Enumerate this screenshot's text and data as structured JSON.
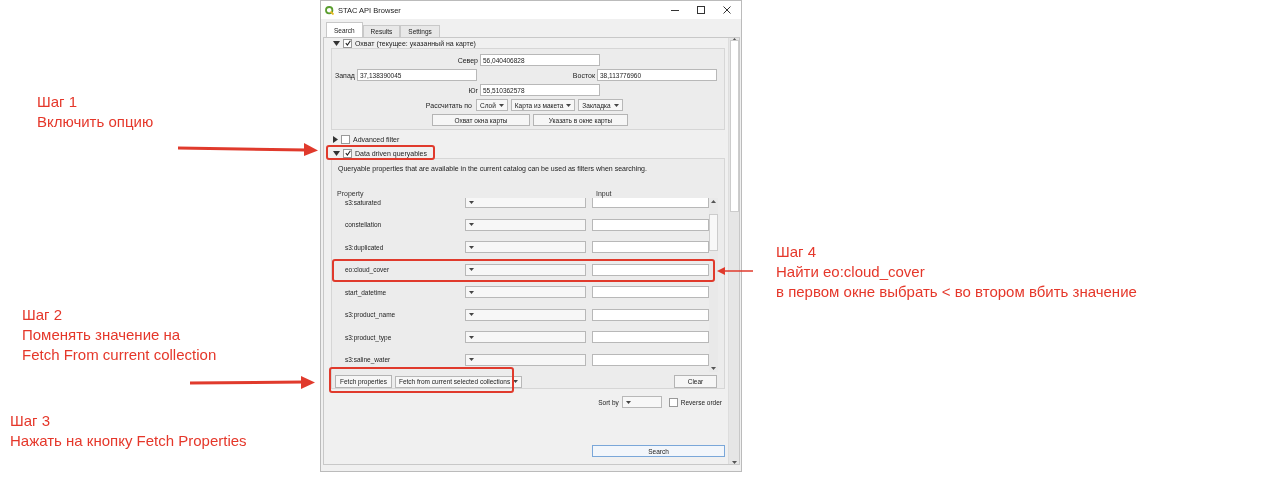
{
  "window": {
    "title": "STAC API Browser"
  },
  "tabs": [
    {
      "label": "Search",
      "selected": true
    },
    {
      "label": "Results",
      "selected": false
    },
    {
      "label": "Settings",
      "selected": false
    }
  ],
  "extent": {
    "title": "Охват (текущее: указанный на карте)",
    "checked": true,
    "expanded": true,
    "north": {
      "label": "Север",
      "value": "56,040406828"
    },
    "west": {
      "label": "Запад",
      "value": "37,138390045"
    },
    "east": {
      "label": "Восток",
      "value": "38,113776960"
    },
    "south": {
      "label": "Юг",
      "value": "55,510362578"
    },
    "calc_label": "Рассчитать по",
    "calc_options": [
      "Слой",
      "Карта из макета",
      "Закладка"
    ],
    "buttons": [
      "Охват окна карты",
      "Указать в окне карты"
    ]
  },
  "advanced_filter": {
    "label": "Advanced filter",
    "checked": false,
    "expanded": false
  },
  "queryables": {
    "label": "Data driven queryables",
    "checked": true,
    "expanded": true,
    "description": "Queryable properties that are available in the current catalog can be used as filters when searching.",
    "columns": [
      "Property",
      "Input"
    ],
    "rows": [
      {
        "property": "s3:saturated"
      },
      {
        "property": "constellation"
      },
      {
        "property": "s3:duplicated"
      },
      {
        "property": "eo:cloud_cover"
      },
      {
        "property": "start_datetime"
      },
      {
        "property": "s3:product_name"
      },
      {
        "property": "s3:product_type"
      },
      {
        "property": "s3:saline_water"
      }
    ],
    "fetch_button": "Fetch properties",
    "fetch_source": "Fetch from current selected collections",
    "clear_button": "Clear"
  },
  "sort": {
    "label": "Sort by",
    "reverse": {
      "label": "Reverse order",
      "checked": false
    }
  },
  "search_button": "Search",
  "annotations": [
    {
      "title": "Шаг 1",
      "lines": [
        "Включить опцию"
      ]
    },
    {
      "title": "Шаг 2",
      "lines": [
        "Поменять значение на",
        "Fetch From current collection"
      ]
    },
    {
      "title": "Шаг 3",
      "lines": [
        "Нажать на кнопку Fetch Properties"
      ]
    },
    {
      "title": "Шаг 4",
      "lines": [
        "Найти eo:cloud_cover",
        "в первом окне выбрать < во втором вбить значение"
      ]
    }
  ]
}
